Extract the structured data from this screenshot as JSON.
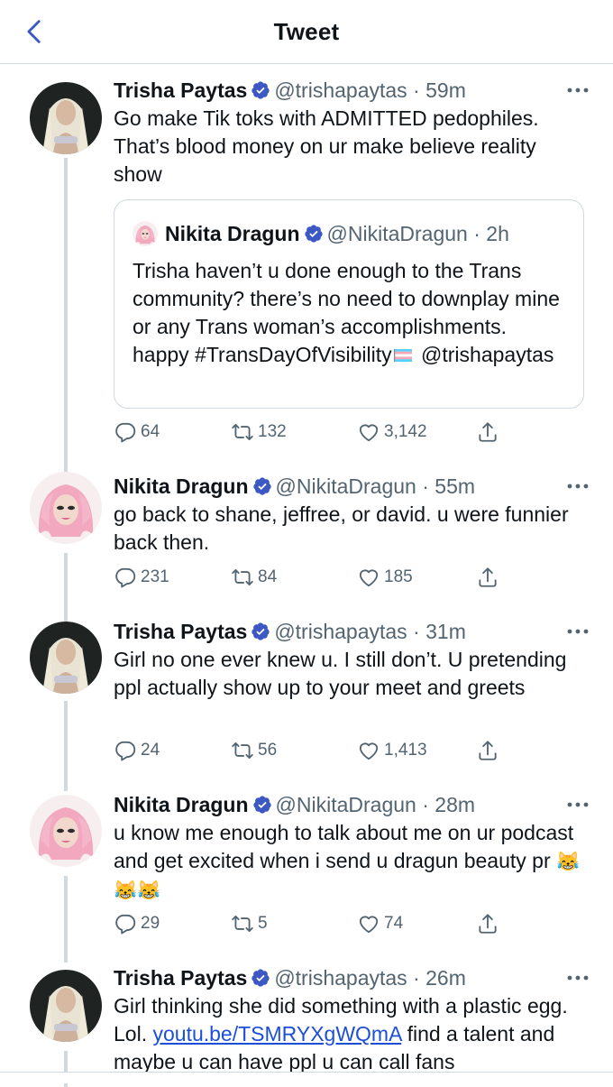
{
  "header": {
    "title": "Tweet"
  },
  "quote": {
    "name": "Nikita Dragun",
    "handle": "@NikitaDragun",
    "time": "2h",
    "text_main": "Trisha haven’t u done enough to the Trans community? there’s no need to downplay mine or any Trans woman’s accomplishments. happy #TransDayOfVisibility",
    "text_mention": "@trishapaytas"
  },
  "tweets": [
    {
      "name": "Trisha Paytas",
      "handle": "@trishapaytas",
      "time": "59m",
      "text": "Go make Tik toks with ADMITTED pedophiles. That’s blood money on ur make believe reality show",
      "replies": "64",
      "retweets": "132",
      "likes": "3,142"
    },
    {
      "name": "Nikita Dragun",
      "handle": "@NikitaDragun",
      "time": "55m",
      "text": "go back to shane, jeffree, or david. u were funnier back then.",
      "replies": "231",
      "retweets": "84",
      "likes": "185"
    },
    {
      "name": "Trisha Paytas",
      "handle": "@trishapaytas",
      "time": "31m",
      "text": "Girl no one ever knew u. I still don’t. U pretending ppl actually show up to your meet and greets",
      "replies": "24",
      "retweets": "56",
      "likes": "1,413"
    },
    {
      "name": "Nikita Dragun",
      "handle": "@NikitaDragun",
      "time": "28m",
      "text": "u know me enough to talk about me on ur podcast and get excited when i send u dragun beauty pr",
      "emoji": "😹😹😹",
      "replies": "29",
      "retweets": "5",
      "likes": "74"
    },
    {
      "name": "Trisha Paytas",
      "handle": "@trishapaytas",
      "time": "26m",
      "text_before": "Girl thinking she did something with a plastic egg. Lol.",
      "link": "youtu.be/TSMRYXgWQmA",
      "text_after": "find a talent and maybe u can have ppl u can call fans"
    }
  ],
  "colors": {
    "accent": "#1d9bf0",
    "verified": "#3b58c4",
    "muted": "#536471",
    "border": "#cfd9de"
  },
  "icons": [
    "back-icon",
    "verified-icon",
    "more-icon",
    "reply-icon",
    "retweet-icon",
    "like-icon",
    "share-icon",
    "trans-flag-icon"
  ]
}
